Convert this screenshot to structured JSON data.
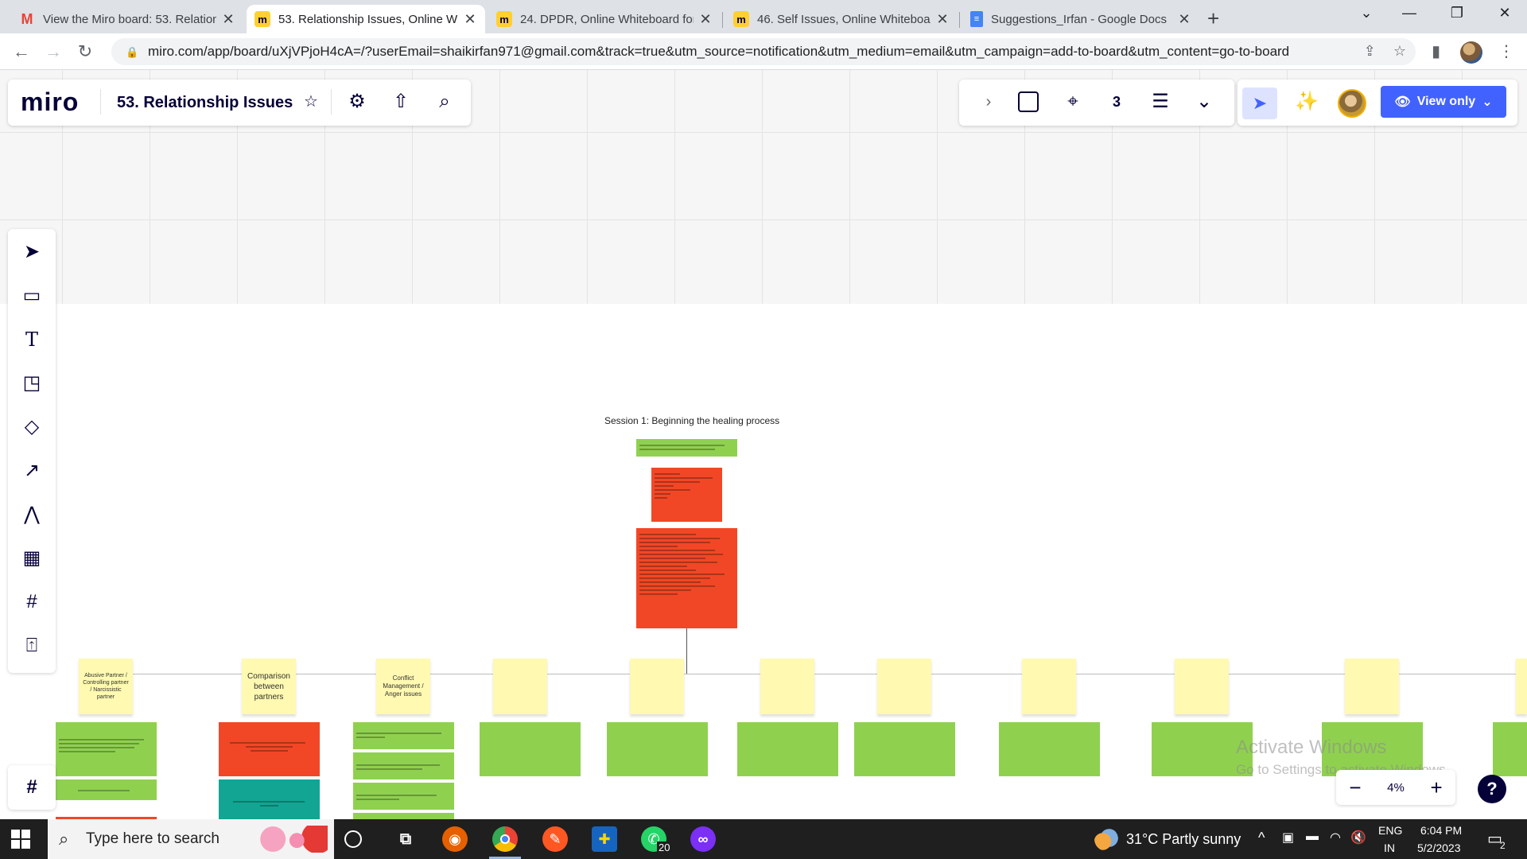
{
  "browser": {
    "tabs": [
      {
        "title": "View the Miro board: 53. Relation",
        "icon": "gmail-icon",
        "active": false
      },
      {
        "title": "53. Relationship Issues, Online W",
        "icon": "miro-icon",
        "active": true
      },
      {
        "title": "24. DPDR, Online Whiteboard for",
        "icon": "miro-icon",
        "active": false
      },
      {
        "title": "46. Self Issues, Online Whiteboar",
        "icon": "miro-icon",
        "active": false
      },
      {
        "title": "Suggestions_Irfan - Google Docs",
        "icon": "docs-icon",
        "active": false
      }
    ],
    "new_tab": "+",
    "url": "miro.com/app/board/uXjVPjoH4cA=/?userEmail=shaikirfan971@gmail.com&track=true&utm_source=notification&utm_medium=email&utm_campaign=add-to-board&utm_content=go-to-board"
  },
  "miro": {
    "logo": "miro",
    "board_title": "53. Relationship Issues",
    "view_mode": "View only",
    "zoom": "4%",
    "help": "?"
  },
  "board": {
    "session_title": "Session 1: Beginning the healing process",
    "topics": [
      "Abusive Partner / Controlling partner / Narcissistic partner",
      "Comparison between partners",
      "Conflict Management / Anger issues"
    ]
  },
  "windows": {
    "watermark_title": "Activate Windows",
    "watermark_sub": "Go to Settings to activate Windows.",
    "search_placeholder": "Type here to search",
    "whatsapp_badge": "20",
    "weather": "31°C  Partly sunny",
    "lang": "ENG",
    "region": "IN",
    "time": "6:04 PM",
    "date": "5/2/2023",
    "notifications": "2"
  },
  "colors": {
    "miro_blue": "#4262ff",
    "sticky_yellow": "#fff9b1",
    "card_green": "#8fd14f",
    "card_red": "#f24726",
    "card_teal": "#12a594"
  }
}
